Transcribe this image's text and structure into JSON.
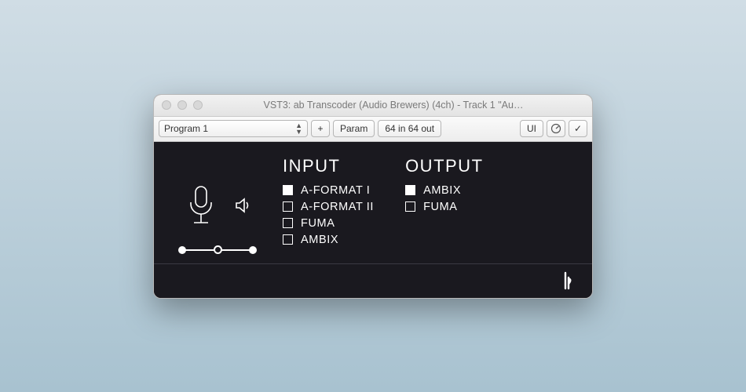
{
  "window": {
    "title": "VST3: ab Transcoder (Audio Brewers) (4ch) - Track 1 \"Au…"
  },
  "toolbar": {
    "program_label": "Program 1",
    "plus_label": "+",
    "param_label": "Param",
    "io_label": "64 in 64 out",
    "ui_label": "UI",
    "check_label": "✓"
  },
  "plugin": {
    "input_heading": "INPUT",
    "output_heading": "OUTPUT",
    "input_options": [
      {
        "label": "A-FORMAT I",
        "checked": true
      },
      {
        "label": "A-FORMAT II",
        "checked": false
      },
      {
        "label": "FUMA",
        "checked": false
      },
      {
        "label": "AMBIX",
        "checked": false
      }
    ],
    "output_options": [
      {
        "label": "AMBIX",
        "checked": true
      },
      {
        "label": "FUMA",
        "checked": false
      }
    ]
  },
  "icons": {
    "mic": "microphone-icon",
    "speaker": "speaker-icon",
    "knob": "knob-icon",
    "logo": "brand-logo-icon"
  }
}
